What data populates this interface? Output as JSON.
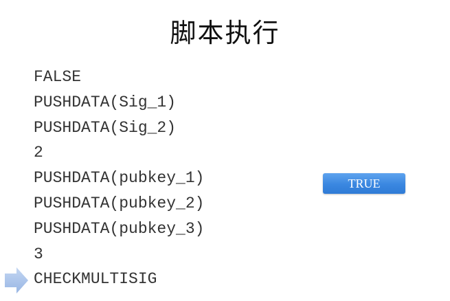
{
  "title": "脚本执行",
  "script": [
    "FALSE",
    "PUSHDATA(Sig_1)",
    "PUSHDATA(Sig_2)",
    "2",
    "PUSHDATA(pubkey_1)",
    "PUSHDATA(pubkey_2)",
    "PUSHDATA(pubkey_3)",
    "3",
    "CHECKMULTISIG"
  ],
  "current_step_index": 8,
  "stack": {
    "items": [
      "TRUE"
    ]
  },
  "colors": {
    "arrow": "#a9c3ea",
    "stack_item": "#3a87e0",
    "text": "#333333"
  },
  "icons": {
    "pointer": "right-arrow-icon"
  }
}
